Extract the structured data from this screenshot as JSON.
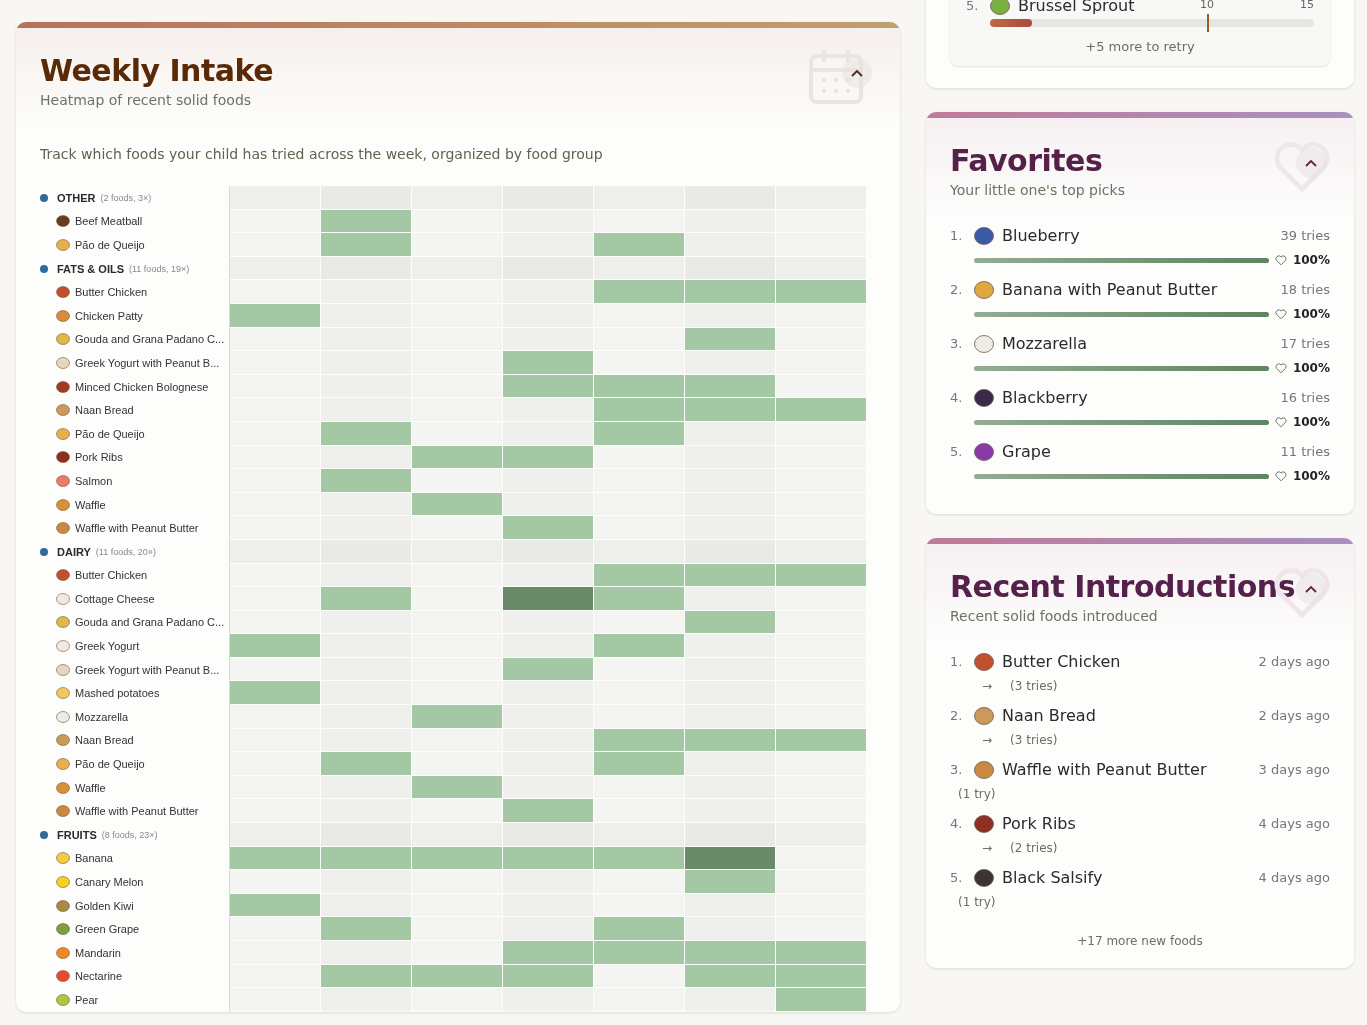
{
  "weekly_intake": {
    "title": "Weekly Intake",
    "subtitle": "Heatmap of recent solid foods",
    "description": "Track which foods your child has tried across the week, organized by food group",
    "groups": [
      {
        "name": "OTHER",
        "summary": "(2 foods, 3×)",
        "items": [
          {
            "name": "Beef Meatball",
            "color": "#6b3a22",
            "cells": [
              {
                "tried": false,
                "often": false
              },
              {
                "tried": true,
                "often": false
              },
              {
                "tried": false,
                "often": false
              },
              {
                "tried": false,
                "often": false
              },
              {
                "tried": false,
                "often": false
              },
              {
                "tried": false,
                "often": false
              },
              {
                "tried": false,
                "often": false
              }
            ]
          },
          {
            "name": "Pão de Queijo",
            "color": "#e8b04a",
            "cells": [
              {
                "tried": false,
                "often": false
              },
              {
                "tried": true,
                "often": false
              },
              {
                "tried": false,
                "often": false
              },
              {
                "tried": false,
                "often": false
              },
              {
                "tried": true,
                "often": false
              },
              {
                "tried": false,
                "often": false
              },
              {
                "tried": false,
                "often": false
              }
            ]
          }
        ]
      },
      {
        "name": "FATS & OILS",
        "summary": "(11 foods, 19×)",
        "items": [
          {
            "name": "Butter Chicken",
            "color": "#c0502e",
            "cells": [
              {
                "tried": false,
                "often": false
              },
              {
                "tried": false,
                "often": false
              },
              {
                "tried": false,
                "often": false
              },
              {
                "tried": false,
                "often": false
              },
              {
                "tried": true,
                "often": false
              },
              {
                "tried": true,
                "often": false
              },
              {
                "tried": true,
                "often": false
              }
            ]
          },
          {
            "name": "Chicken Patty",
            "color": "#d98a3a",
            "cells": [
              {
                "tried": true,
                "often": false
              },
              {
                "tried": false,
                "often": false
              },
              {
                "tried": false,
                "often": false
              },
              {
                "tried": false,
                "often": false
              },
              {
                "tried": false,
                "often": false
              },
              {
                "tried": false,
                "often": false
              },
              {
                "tried": false,
                "often": false
              }
            ]
          },
          {
            "name": "Gouda and Grana Padano C...",
            "color": "#e0b84a",
            "cells": [
              {
                "tried": false,
                "often": false
              },
              {
                "tried": false,
                "often": false
              },
              {
                "tried": false,
                "often": false
              },
              {
                "tried": false,
                "often": false
              },
              {
                "tried": false,
                "often": false
              },
              {
                "tried": true,
                "often": false
              },
              {
                "tried": false,
                "often": false
              }
            ]
          },
          {
            "name": "Greek Yogurt with Peanut B...",
            "color": "#e6d8c0",
            "cells": [
              {
                "tried": false,
                "often": false
              },
              {
                "tried": false,
                "often": false
              },
              {
                "tried": false,
                "often": false
              },
              {
                "tried": true,
                "often": false
              },
              {
                "tried": false,
                "often": false
              },
              {
                "tried": false,
                "often": false
              },
              {
                "tried": false,
                "often": false
              }
            ]
          },
          {
            "name": "Minced Chicken Bolognese",
            "color": "#a23a22",
            "cells": [
              {
                "tried": false,
                "often": false
              },
              {
                "tried": false,
                "often": false
              },
              {
                "tried": false,
                "often": false
              },
              {
                "tried": true,
                "often": false
              },
              {
                "tried": true,
                "often": false
              },
              {
                "tried": true,
                "often": false
              },
              {
                "tried": false,
                "often": false
              }
            ]
          },
          {
            "name": "Naan Bread",
            "color": "#c99a5a",
            "cells": [
              {
                "tried": false,
                "often": false
              },
              {
                "tried": false,
                "often": false
              },
              {
                "tried": false,
                "often": false
              },
              {
                "tried": false,
                "often": false
              },
              {
                "tried": true,
                "often": false
              },
              {
                "tried": true,
                "often": false
              },
              {
                "tried": true,
                "often": false
              }
            ]
          },
          {
            "name": "Pão de Queijo",
            "color": "#e8b04a",
            "cells": [
              {
                "tried": false,
                "often": false
              },
              {
                "tried": true,
                "often": false
              },
              {
                "tried": false,
                "often": false
              },
              {
                "tried": false,
                "often": false
              },
              {
                "tried": true,
                "often": false
              },
              {
                "tried": false,
                "often": false
              },
              {
                "tried": false,
                "often": false
              }
            ]
          },
          {
            "name": "Pork Ribs",
            "color": "#8e3020",
            "cells": [
              {
                "tried": false,
                "often": false
              },
              {
                "tried": false,
                "often": false
              },
              {
                "tried": true,
                "often": false
              },
              {
                "tried": true,
                "often": false
              },
              {
                "tried": false,
                "often": false
              },
              {
                "tried": false,
                "often": false
              },
              {
                "tried": false,
                "often": false
              }
            ]
          },
          {
            "name": "Salmon",
            "color": "#ec7a6a",
            "cells": [
              {
                "tried": false,
                "often": false
              },
              {
                "tried": true,
                "often": false
              },
              {
                "tried": false,
                "often": false
              },
              {
                "tried": false,
                "often": false
              },
              {
                "tried": false,
                "often": false
              },
              {
                "tried": false,
                "often": false
              },
              {
                "tried": false,
                "often": false
              }
            ]
          },
          {
            "name": "Waffle",
            "color": "#d9903a",
            "cells": [
              {
                "tried": false,
                "often": false
              },
              {
                "tried": false,
                "often": false
              },
              {
                "tried": true,
                "often": false
              },
              {
                "tried": false,
                "often": false
              },
              {
                "tried": false,
                "often": false
              },
              {
                "tried": false,
                "often": false
              },
              {
                "tried": false,
                "often": false
              }
            ]
          },
          {
            "name": "Waffle with Peanut Butter",
            "color": "#c98a40",
            "cells": [
              {
                "tried": false,
                "often": false
              },
              {
                "tried": false,
                "often": false
              },
              {
                "tried": false,
                "often": false
              },
              {
                "tried": true,
                "often": false
              },
              {
                "tried": false,
                "often": false
              },
              {
                "tried": false,
                "often": false
              },
              {
                "tried": false,
                "often": false
              }
            ]
          }
        ]
      },
      {
        "name": "DAIRY",
        "summary": "(11 foods, 20×)",
        "items": [
          {
            "name": "Butter Chicken",
            "color": "#c0502e",
            "cells": [
              {
                "tried": false,
                "often": false
              },
              {
                "tried": false,
                "often": false
              },
              {
                "tried": false,
                "often": false
              },
              {
                "tried": false,
                "often": false
              },
              {
                "tried": true,
                "often": false
              },
              {
                "tried": true,
                "often": false
              },
              {
                "tried": true,
                "often": false
              }
            ]
          },
          {
            "name": "Cottage Cheese",
            "color": "#eeeae0",
            "cells": [
              {
                "tried": false,
                "often": false
              },
              {
                "tried": true,
                "often": false
              },
              {
                "tried": false,
                "often": false
              },
              {
                "tried": true,
                "often": true
              },
              {
                "tried": true,
                "often": false
              },
              {
                "tried": false,
                "often": false
              },
              {
                "tried": false,
                "often": false
              }
            ]
          },
          {
            "name": "Gouda and Grana Padano C...",
            "color": "#e0b84a",
            "cells": [
              {
                "tried": false,
                "often": false
              },
              {
                "tried": false,
                "often": false
              },
              {
                "tried": false,
                "often": false
              },
              {
                "tried": false,
                "often": false
              },
              {
                "tried": false,
                "often": false
              },
              {
                "tried": true,
                "often": false
              },
              {
                "tried": false,
                "often": false
              }
            ]
          },
          {
            "name": "Greek Yogurt",
            "color": "#eeeae0",
            "cells": [
              {
                "tried": true,
                "often": false
              },
              {
                "tried": false,
                "often": false
              },
              {
                "tried": false,
                "often": false
              },
              {
                "tried": false,
                "often": false
              },
              {
                "tried": true,
                "often": false
              },
              {
                "tried": false,
                "often": false
              },
              {
                "tried": false,
                "often": false
              }
            ]
          },
          {
            "name": "Greek Yogurt with Peanut B...",
            "color": "#e6d8c0",
            "cells": [
              {
                "tried": false,
                "often": false
              },
              {
                "tried": false,
                "often": false
              },
              {
                "tried": false,
                "often": false
              },
              {
                "tried": true,
                "often": false
              },
              {
                "tried": false,
                "often": false
              },
              {
                "tried": false,
                "often": false
              },
              {
                "tried": false,
                "often": false
              }
            ]
          },
          {
            "name": "Mashed potatoes",
            "color": "#f0c860",
            "cells": [
              {
                "tried": true,
                "often": false
              },
              {
                "tried": false,
                "often": false
              },
              {
                "tried": false,
                "often": false
              },
              {
                "tried": false,
                "often": false
              },
              {
                "tried": false,
                "often": false
              },
              {
                "tried": false,
                "often": false
              },
              {
                "tried": false,
                "often": false
              }
            ]
          },
          {
            "name": "Mozzarella",
            "color": "#eeeae4",
            "cells": [
              {
                "tried": false,
                "often": false
              },
              {
                "tried": false,
                "often": false
              },
              {
                "tried": true,
                "often": false
              },
              {
                "tried": false,
                "often": false
              },
              {
                "tried": false,
                "often": false
              },
              {
                "tried": false,
                "often": false
              },
              {
                "tried": false,
                "often": false
              }
            ]
          },
          {
            "name": "Naan Bread",
            "color": "#c99a5a",
            "cells": [
              {
                "tried": false,
                "often": false
              },
              {
                "tried": false,
                "often": false
              },
              {
                "tried": false,
                "often": false
              },
              {
                "tried": false,
                "often": false
              },
              {
                "tried": true,
                "often": false
              },
              {
                "tried": true,
                "often": false
              },
              {
                "tried": true,
                "often": false
              }
            ]
          },
          {
            "name": "Pão de Queijo",
            "color": "#e8b04a",
            "cells": [
              {
                "tried": false,
                "often": false
              },
              {
                "tried": true,
                "often": false
              },
              {
                "tried": false,
                "often": false
              },
              {
                "tried": false,
                "often": false
              },
              {
                "tried": true,
                "often": false
              },
              {
                "tried": false,
                "often": false
              },
              {
                "tried": false,
                "often": false
              }
            ]
          },
          {
            "name": "Waffle",
            "color": "#d9903a",
            "cells": [
              {
                "tried": false,
                "often": false
              },
              {
                "tried": false,
                "often": false
              },
              {
                "tried": true,
                "often": false
              },
              {
                "tried": false,
                "often": false
              },
              {
                "tried": false,
                "often": false
              },
              {
                "tried": false,
                "often": false
              },
              {
                "tried": false,
                "often": false
              }
            ]
          },
          {
            "name": "Waffle with Peanut Butter",
            "color": "#c98a40",
            "cells": [
              {
                "tried": false,
                "often": false
              },
              {
                "tried": false,
                "often": false
              },
              {
                "tried": false,
                "often": false
              },
              {
                "tried": true,
                "often": false
              },
              {
                "tried": false,
                "often": false
              },
              {
                "tried": false,
                "often": false
              },
              {
                "tried": false,
                "often": false
              }
            ]
          }
        ]
      },
      {
        "name": "FRUITS",
        "summary": "(8 foods, 23×)",
        "items": [
          {
            "name": "Banana",
            "color": "#f2cc40",
            "cells": [
              {
                "tried": true,
                "often": false
              },
              {
                "tried": true,
                "often": false
              },
              {
                "tried": true,
                "often": false
              },
              {
                "tried": true,
                "often": false
              },
              {
                "tried": true,
                "often": false
              },
              {
                "tried": true,
                "often": true
              },
              {
                "tried": false,
                "often": false
              }
            ]
          },
          {
            "name": "Canary Melon",
            "color": "#f5d020",
            "cells": [
              {
                "tried": false,
                "often": false
              },
              {
                "tried": false,
                "often": false
              },
              {
                "tried": false,
                "often": false
              },
              {
                "tried": false,
                "often": false
              },
              {
                "tried": false,
                "often": false
              },
              {
                "tried": true,
                "often": false
              },
              {
                "tried": false,
                "often": false
              }
            ]
          },
          {
            "name": "Golden Kiwi",
            "color": "#a88a40",
            "cells": [
              {
                "tried": true,
                "often": false
              },
              {
                "tried": false,
                "often": false
              },
              {
                "tried": false,
                "often": false
              },
              {
                "tried": false,
                "often": false
              },
              {
                "tried": false,
                "often": false
              },
              {
                "tried": false,
                "often": false
              },
              {
                "tried": false,
                "often": false
              }
            ]
          },
          {
            "name": "Green Grape",
            "color": "#7aa040",
            "cells": [
              {
                "tried": false,
                "often": false
              },
              {
                "tried": true,
                "often": false
              },
              {
                "tried": false,
                "often": false
              },
              {
                "tried": false,
                "often": false
              },
              {
                "tried": true,
                "often": false
              },
              {
                "tried": false,
                "often": false
              },
              {
                "tried": false,
                "often": false
              }
            ]
          },
          {
            "name": "Mandarin",
            "color": "#f08a20",
            "cells": [
              {
                "tried": false,
                "often": false
              },
              {
                "tried": false,
                "often": false
              },
              {
                "tried": false,
                "often": false
              },
              {
                "tried": true,
                "often": false
              },
              {
                "tried": true,
                "often": false
              },
              {
                "tried": true,
                "often": false
              },
              {
                "tried": true,
                "often": false
              }
            ]
          },
          {
            "name": "Nectarine",
            "color": "#e84a30",
            "cells": [
              {
                "tried": false,
                "often": false
              },
              {
                "tried": true,
                "often": false
              },
              {
                "tried": true,
                "often": false
              },
              {
                "tried": true,
                "often": false
              },
              {
                "tried": false,
                "often": false
              },
              {
                "tried": true,
                "often": false
              },
              {
                "tried": true,
                "often": false
              }
            ]
          },
          {
            "name": "Pear",
            "color": "#a8c840",
            "cells": [
              {
                "tried": false,
                "often": false
              },
              {
                "tried": false,
                "often": false
              },
              {
                "tried": false,
                "often": false
              },
              {
                "tried": false,
                "often": false
              },
              {
                "tried": false,
                "often": false
              },
              {
                "tried": false,
                "often": false
              },
              {
                "tried": true,
                "often": false
              }
            ]
          }
        ]
      }
    ]
  },
  "retry": {
    "rank": "5.",
    "name": "Brussel Sprout",
    "color": "#7ab040",
    "level": 0.13,
    "target": {
      "label": "10",
      "level": 0.67
    },
    "max_label": "15",
    "more": "+5 more to retry"
  },
  "favorites": {
    "title": "Favorites",
    "subtitle": "Your little one's top picks",
    "items": [
      {
        "rank": "1.",
        "name": "Blueberry",
        "color": "#3a5aa8",
        "tries": "39 tries",
        "level": 1,
        "percent": "100%"
      },
      {
        "rank": "2.",
        "name": "Banana with Peanut Butter",
        "color": "#e0a840",
        "tries": "18 tries",
        "level": 1,
        "percent": "100%"
      },
      {
        "rank": "3.",
        "name": "Mozzarella",
        "color": "#eeeae4",
        "tries": "17 tries",
        "level": 1,
        "percent": "100%"
      },
      {
        "rank": "4.",
        "name": "Blackberry",
        "color": "#3a2a4a",
        "tries": "16 tries",
        "level": 1,
        "percent": "100%"
      },
      {
        "rank": "5.",
        "name": "Grape",
        "color": "#8a3aa8",
        "tries": "11 tries",
        "level": 1,
        "percent": "100%"
      }
    ]
  },
  "recent": {
    "title": "Recent Introductions",
    "subtitle": "Recent solid foods introduced",
    "items": [
      {
        "rank": "1.",
        "name": "Butter Chicken",
        "color": "#c0502e",
        "when": "2 days ago",
        "arrow": "→",
        "tries": "(3 tries)"
      },
      {
        "rank": "2.",
        "name": "Naan Bread",
        "color": "#c99a5a",
        "when": "2 days ago",
        "arrow": "→",
        "tries": "(3 tries)"
      },
      {
        "rank": "3.",
        "name": "Waffle with Peanut Butter",
        "color": "#c98a40",
        "when": "3 days ago",
        "tries": "(1 try)"
      },
      {
        "rank": "4.",
        "name": "Pork Ribs",
        "color": "#8e3020",
        "when": "4 days ago",
        "arrow": "→",
        "tries": "(2 tries)"
      },
      {
        "rank": "5.",
        "name": "Black Salsify",
        "color": "#3a3530",
        "when": "4 days ago",
        "tries": "(1 try)"
      }
    ],
    "more": "+17 more new foods"
  }
}
